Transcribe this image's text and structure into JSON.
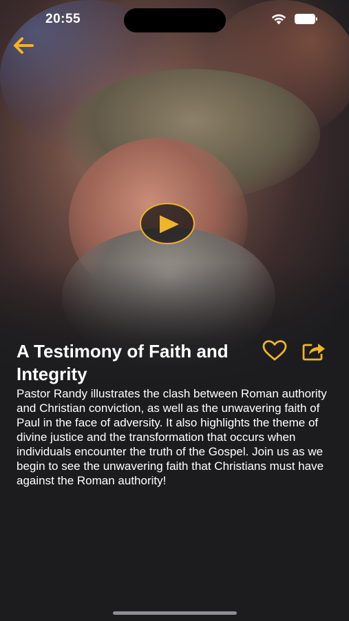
{
  "status_bar": {
    "time": "20:55"
  },
  "video": {
    "title": "A Testimony of Faith and Integrity",
    "description": "Pastor Randy illustrates the clash between Roman authority and Christian conviction, as well as the unwavering faith of Paul in the face of adversity. It also highlights the theme of divine justice and the transformation that occurs when individuals encounter the truth of the Gospel. Join us as we begin to see the unwavering faith that Christians must have against the Roman authority!"
  },
  "icons": {
    "back": "arrow-left-icon",
    "play": "play-icon",
    "favorite": "heart-icon",
    "share": "share-icon"
  },
  "colors": {
    "accent": "#f0b429",
    "background": "#1c1c1e"
  }
}
